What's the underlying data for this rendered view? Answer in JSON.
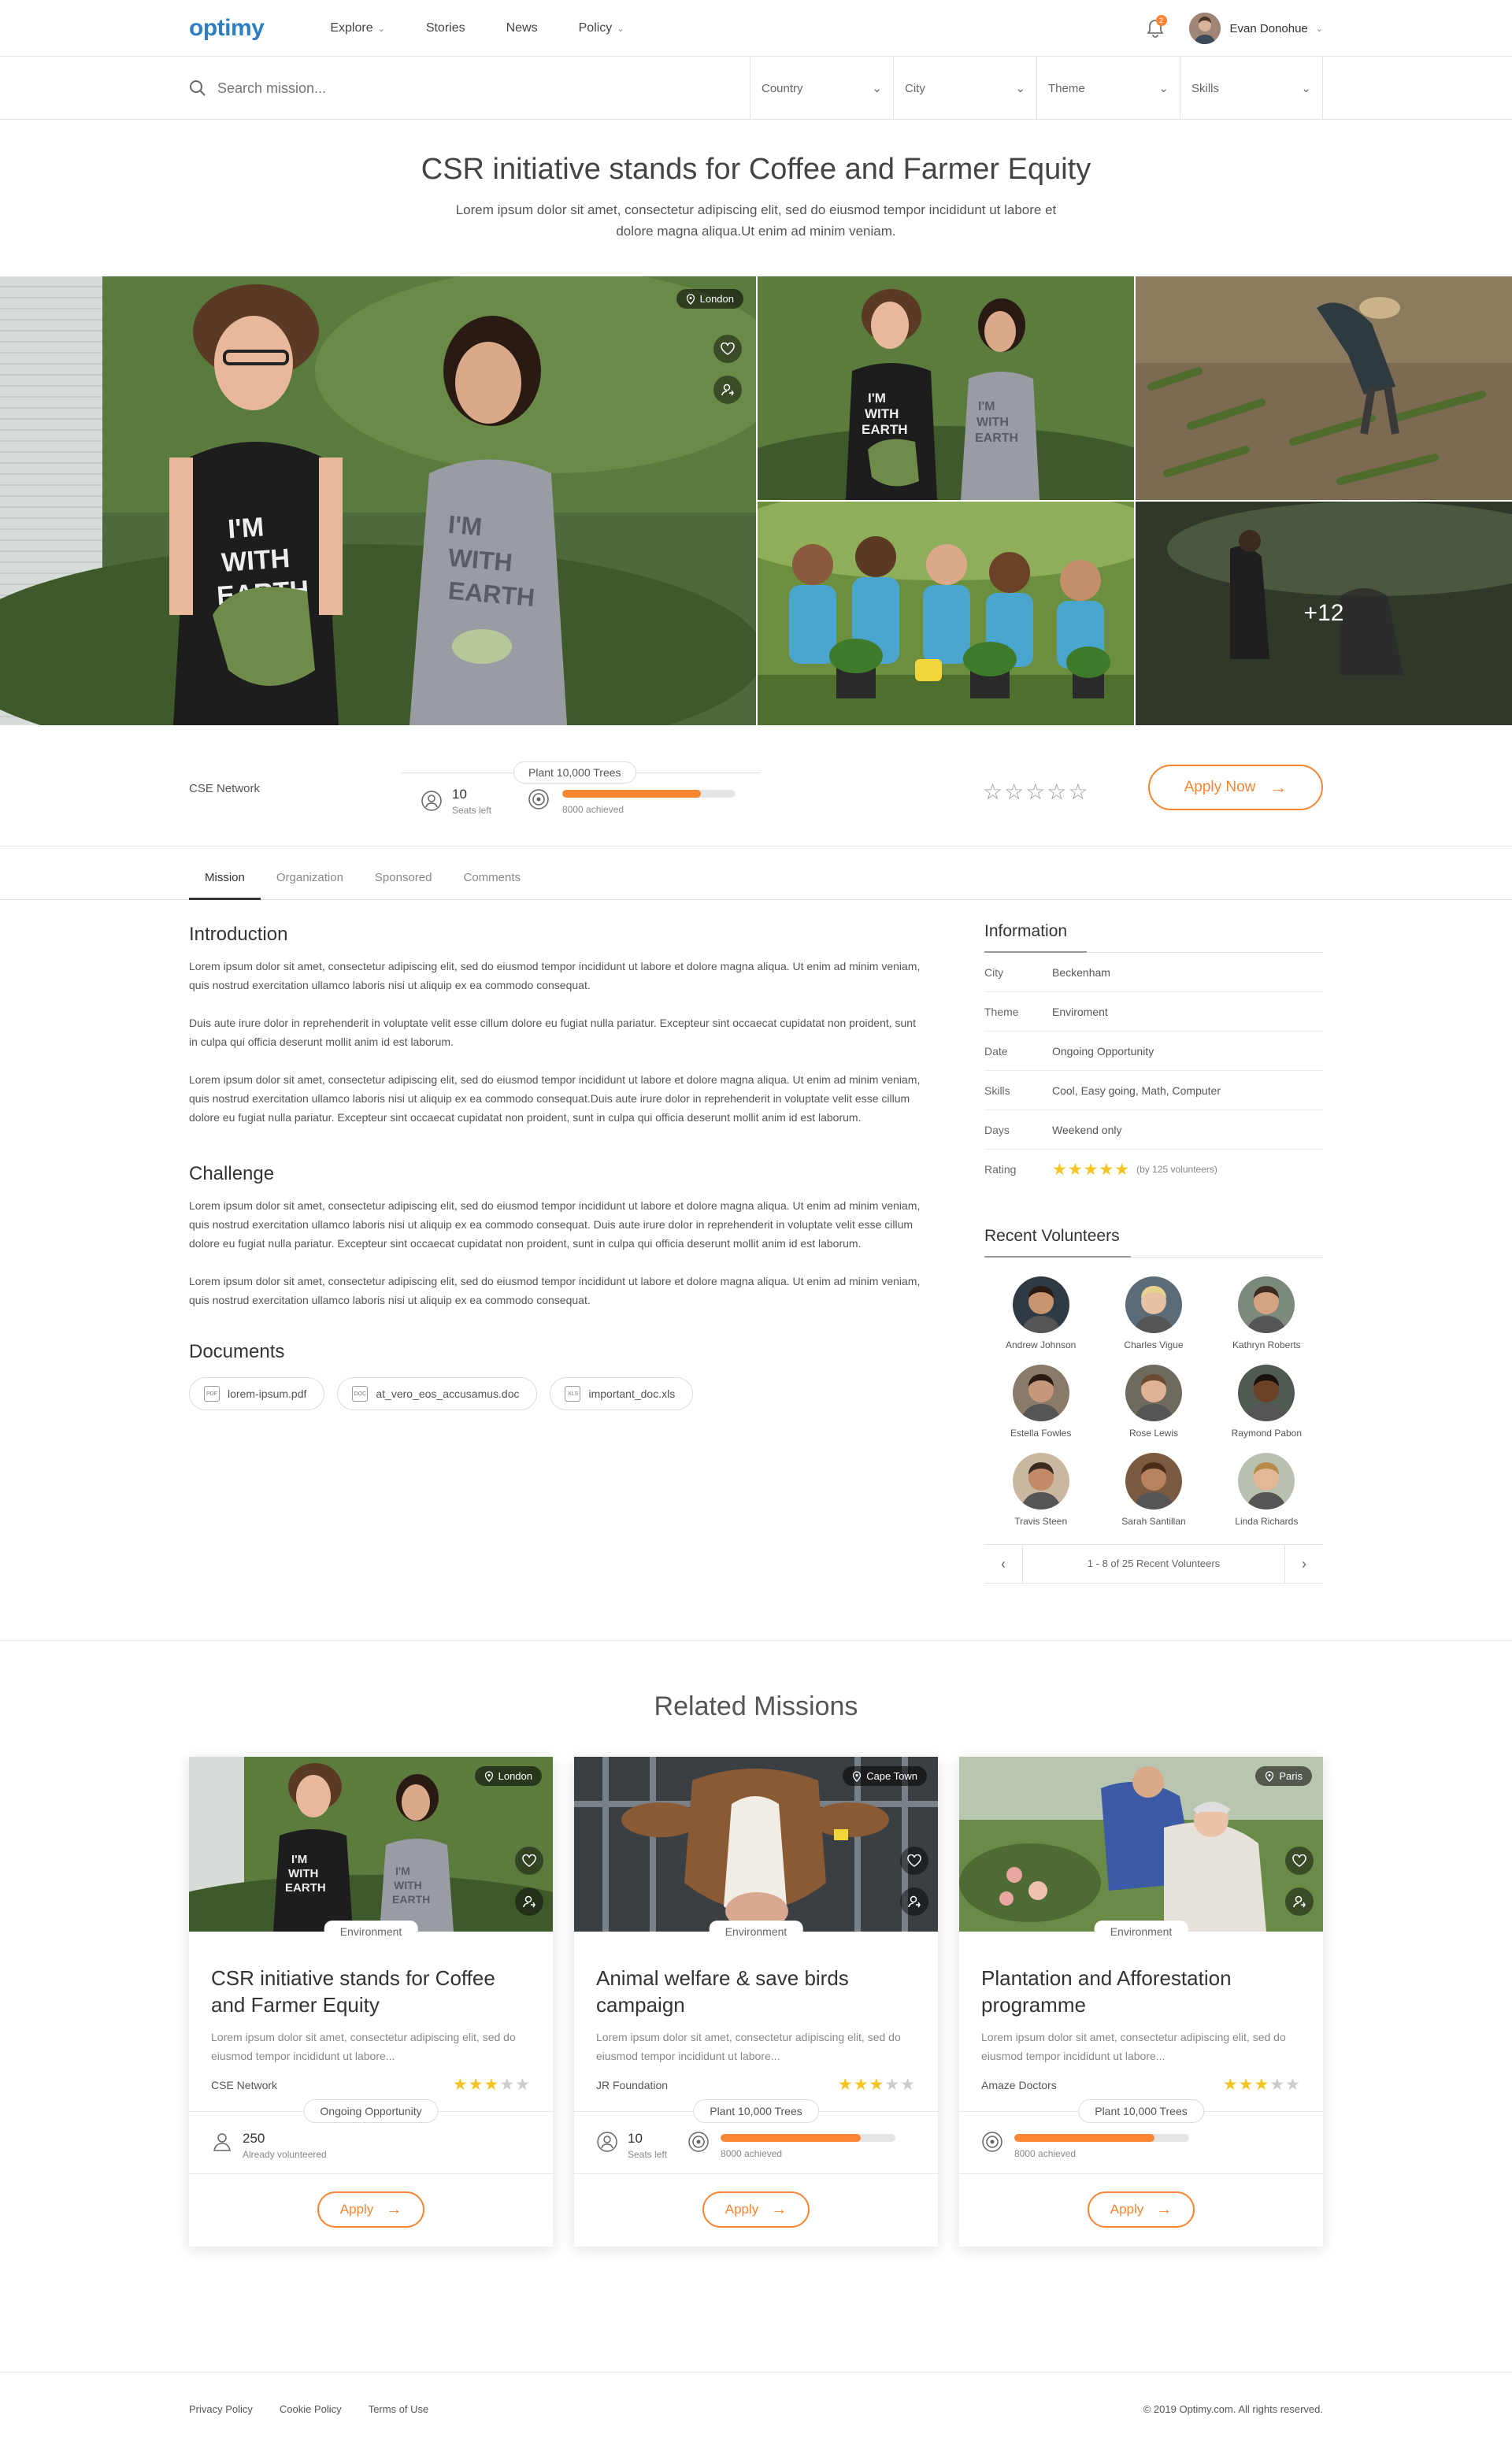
{
  "brand": {
    "logo": "optimy",
    "accent": "#f88634",
    "logo_color": "#2e7fc2"
  },
  "nav": {
    "items": [
      {
        "label": "Explore",
        "dropdown": true
      },
      {
        "label": "Stories",
        "dropdown": false
      },
      {
        "label": "News",
        "dropdown": false
      },
      {
        "label": "Policy",
        "dropdown": true
      }
    ],
    "notifications_count": "2",
    "user_name": "Evan Donohue"
  },
  "search": {
    "placeholder": "Search mission...",
    "filters": [
      "Country",
      "City",
      "Theme",
      "Skills"
    ]
  },
  "hero": {
    "title": "CSR initiative stands for Coffee and Farmer Equity",
    "description": "Lorem ipsum dolor sit amet, consectetur adipiscing elit, sed do eiusmod tempor incididunt ut labore et dolore magna aliqua.Ut enim ad minim veniam.",
    "location": "London",
    "more_photos": "+12"
  },
  "stats": {
    "organization": "CSE Network",
    "goal": "Plant 10,000 Trees",
    "seats_count": "10",
    "seats_label": "Seats left",
    "achieved_label": "8000 achieved",
    "progress": 0.8,
    "apply_label": "Apply Now"
  },
  "tabs": [
    "Mission",
    "Organization",
    "Sponsored",
    "Comments"
  ],
  "mission": {
    "intro_title": "Introduction",
    "intro_paragraphs": [
      "Lorem ipsum dolor sit amet, consectetur adipiscing elit, sed do eiusmod tempor incididunt ut labore et dolore magna aliqua. Ut enim ad minim veniam, quis nostrud exercitation ullamco laboris nisi ut aliquip ex ea commodo consequat.",
      "Duis aute irure dolor in reprehenderit in voluptate velit esse cillum dolore eu fugiat nulla pariatur. Excepteur sint occaecat cupidatat non proident, sunt in culpa qui officia deserunt mollit anim id est laborum.",
      "Lorem ipsum dolor sit amet, consectetur adipiscing elit, sed do eiusmod tempor incididunt ut labore et dolore magna aliqua. Ut enim ad minim veniam, quis nostrud exercitation ullamco laboris nisi ut aliquip ex ea commodo consequat.Duis aute irure dolor in reprehenderit in voluptate velit esse cillum dolore eu fugiat nulla pariatur. Excepteur sint occaecat cupidatat non proident, sunt in culpa qui officia deserunt mollit anim id est laborum."
    ],
    "challenge_title": "Challenge",
    "challenge_paragraphs": [
      "Lorem ipsum dolor sit amet, consectetur adipiscing elit, sed do eiusmod tempor incididunt ut labore et dolore magna aliqua. Ut enim ad minim veniam, quis nostrud exercitation ullamco laboris nisi ut aliquip ex ea commodo consequat. Duis aute irure dolor in reprehenderit in voluptate velit esse cillum dolore eu fugiat nulla pariatur. Excepteur sint occaecat cupidatat non proident, sunt in culpa qui officia deserunt mollit anim id est laborum.",
      "Lorem ipsum dolor sit amet, consectetur adipiscing elit, sed do eiusmod tempor incididunt ut labore et dolore magna aliqua. Ut enim ad minim veniam, quis nostrud exercitation ullamco laboris nisi ut aliquip ex ea commodo consequat."
    ],
    "documents_title": "Documents",
    "documents": [
      {
        "name": "lorem-ipsum.pdf",
        "ext": "PDF"
      },
      {
        "name": "at_vero_eos_accusamus.doc",
        "ext": "DOC"
      },
      {
        "name": "important_doc.xls",
        "ext": "XLS"
      }
    ]
  },
  "information": {
    "title": "Information",
    "rows": [
      {
        "k": "City",
        "v": "Beckenham"
      },
      {
        "k": "Theme",
        "v": "Enviroment"
      },
      {
        "k": "Date",
        "v": "Ongoing Opportunity"
      },
      {
        "k": "Skills",
        "v": "Cool, Easy going, Math, Computer"
      },
      {
        "k": "Days",
        "v": "Weekend only"
      }
    ],
    "rating_label": "Rating",
    "rating_stars": 5,
    "rating_note": "(by 125 volunteers)"
  },
  "volunteers": {
    "title": "Recent Volunteers",
    "people": [
      "Andrew Johnson",
      "Charles Vigue",
      "Kathryn Roberts",
      "Estella Fowles",
      "Rose Lewis",
      "Raymond Pabon",
      "Travis Steen",
      "Sarah Santillan",
      "Linda Richards"
    ],
    "pager": "1 - 8 of 25 Recent Volunteers"
  },
  "related": {
    "title": "Related Missions",
    "cards": [
      {
        "location": "London",
        "badge": "Environment",
        "title": "CSR initiative stands for Coffee and Farmer Equity",
        "desc": "Lorem ipsum dolor sit amet, consectetur adipiscing elit, sed do eiusmod tempor incididunt ut labore...",
        "org": "CSE Network",
        "rating": 3,
        "pill": "Ongoing Opportunity",
        "stat_num": "250",
        "stat_label": "Already volunteered",
        "apply": "Apply"
      },
      {
        "location": "Cape Town",
        "badge": "Environment",
        "title": "Animal welfare & save birds campaign",
        "desc": "Lorem ipsum dolor sit amet, consectetur adipiscing elit, sed do eiusmod tempor incididunt ut labore...",
        "org": "JR Foundation",
        "rating": 3,
        "pill": "Plant 10,000 Trees",
        "stat_num": "10",
        "stat_label": "Seats left",
        "achieved": "8000 achieved",
        "progress": 0.8,
        "apply": "Apply"
      },
      {
        "location": "Paris",
        "badge": "Environment",
        "title": "Plantation and Afforestation programme",
        "desc": "Lorem ipsum dolor sit amet, consectetur adipiscing elit, sed do eiusmod tempor incididunt ut labore...",
        "org": "Amaze Doctors",
        "rating": 3,
        "pill": "Plant 10,000 Trees",
        "achieved": "8000 achieved",
        "progress": 0.8,
        "apply": "Apply"
      }
    ]
  },
  "footer": {
    "links": [
      "Privacy Policy",
      "Cookie Policy",
      "Terms of Use"
    ],
    "copyright": "© 2019 Optimy.com. All rights reserved."
  }
}
